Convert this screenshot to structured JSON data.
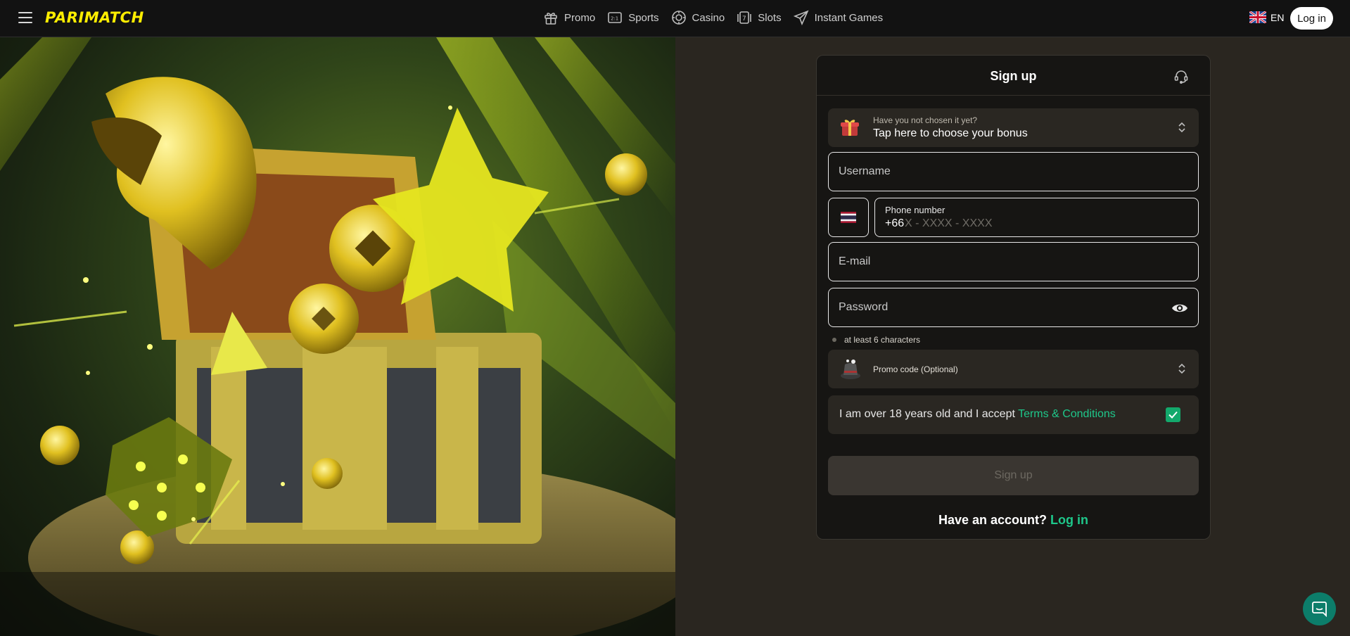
{
  "header": {
    "logo": "PARIMATCH",
    "nav": [
      {
        "label": "Promo",
        "icon": "gift-icon"
      },
      {
        "label": "Sports",
        "icon": "scoreboard-icon"
      },
      {
        "label": "Casino",
        "icon": "chip-icon"
      },
      {
        "label": "Slots",
        "icon": "slot-7-icon"
      },
      {
        "label": "Instant Games",
        "icon": "plane-icon"
      }
    ],
    "language": "EN",
    "login_label": "Log in"
  },
  "signup": {
    "title": "Sign up",
    "bonus": {
      "hint": "Have you not chosen it yet?",
      "main": "Tap here to choose your bonus"
    },
    "username_placeholder": "Username",
    "phone": {
      "label": "Phone number",
      "code": "+66",
      "mask": "X - XXXX - XXXX"
    },
    "email_placeholder": "E-mail",
    "password_placeholder": "Password",
    "password_rule": "at least 6 characters",
    "promo_label": "Promo code (Optional)",
    "terms_text": "I am over 18 years old and I accept ",
    "terms_link": "Terms & Conditions",
    "terms_checked": true,
    "submit_label": "Sign up",
    "have_account": "Have an account?",
    "login_link": "Log in"
  },
  "colors": {
    "brand": "#ffee00",
    "accent_green": "#1ec78a",
    "checkbox": "#13a96c",
    "background": "#2a2620",
    "card": "#161513"
  }
}
